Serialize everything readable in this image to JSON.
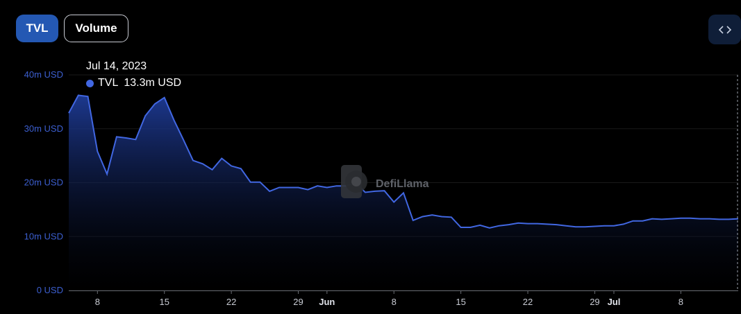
{
  "toggles": {
    "tvl_label": "TVL",
    "volume_label": "Volume"
  },
  "embed_icon": "code-brackets-icon",
  "tooltip": {
    "date": "Jul 14, 2023",
    "series": "TVL",
    "value": "13.3m USD",
    "color": "#4167e2"
  },
  "watermark": {
    "text": "DefiLlama",
    "icon": "llama-logo-icon"
  },
  "colors": {
    "line": "#4167e2",
    "fill_top": "#1e3b96",
    "background": "#000000",
    "grid": "#1a1a1a"
  },
  "chart_data": {
    "type": "area",
    "title": "",
    "xlabel": "",
    "ylabel": "",
    "series": [
      {
        "name": "TVL",
        "x": [
          "2023-05-05",
          "2023-05-06",
          "2023-05-07",
          "2023-05-08",
          "2023-05-09",
          "2023-05-10",
          "2023-05-11",
          "2023-05-12",
          "2023-05-13",
          "2023-05-14",
          "2023-05-15",
          "2023-05-16",
          "2023-05-17",
          "2023-05-18",
          "2023-05-19",
          "2023-05-20",
          "2023-05-21",
          "2023-05-22",
          "2023-05-23",
          "2023-05-24",
          "2023-05-25",
          "2023-05-26",
          "2023-05-27",
          "2023-05-28",
          "2023-05-29",
          "2023-05-30",
          "2023-05-31",
          "2023-06-01",
          "2023-06-02",
          "2023-06-03",
          "2023-06-04",
          "2023-06-05",
          "2023-06-06",
          "2023-06-07",
          "2023-06-08",
          "2023-06-09",
          "2023-06-10",
          "2023-06-11",
          "2023-06-12",
          "2023-06-13",
          "2023-06-14",
          "2023-06-15",
          "2023-06-16",
          "2023-06-17",
          "2023-06-18",
          "2023-06-19",
          "2023-06-20",
          "2023-06-21",
          "2023-06-22",
          "2023-06-23",
          "2023-06-24",
          "2023-06-25",
          "2023-06-26",
          "2023-06-27",
          "2023-06-28",
          "2023-06-29",
          "2023-06-30",
          "2023-07-01",
          "2023-07-02",
          "2023-07-03",
          "2023-07-04",
          "2023-07-05",
          "2023-07-06",
          "2023-07-07",
          "2023-07-08",
          "2023-07-09",
          "2023-07-10",
          "2023-07-11",
          "2023-07-12",
          "2023-07-13",
          "2023-07-14"
        ],
        "values": [
          32.9,
          36.2,
          36.0,
          25.8,
          21.6,
          28.5,
          28.3,
          28.0,
          32.4,
          34.6,
          35.8,
          31.6,
          27.9,
          24.1,
          23.5,
          22.4,
          24.5,
          23.1,
          22.6,
          20.1,
          20.1,
          18.4,
          19.1,
          19.1,
          19.1,
          18.7,
          19.4,
          19.1,
          19.4,
          19.4,
          20.0,
          18.2,
          18.4,
          18.5,
          16.4,
          18.1,
          13.0,
          13.7,
          14.0,
          13.7,
          13.6,
          11.7,
          11.7,
          12.1,
          11.6,
          12.0,
          12.2,
          12.5,
          12.4,
          12.4,
          12.3,
          12.2,
          12.0,
          11.8,
          11.8,
          11.9,
          12.0,
          12.0,
          12.3,
          12.9,
          12.9,
          13.3,
          13.2,
          13.3,
          13.4,
          13.4,
          13.3,
          13.3,
          13.2,
          13.2,
          13.3
        ]
      }
    ],
    "ylim": [
      0,
      40
    ],
    "y_ticks": [
      {
        "value": 0,
        "label": "0 USD"
      },
      {
        "value": 10,
        "label": "10m USD"
      },
      {
        "value": 20,
        "label": "20m USD"
      },
      {
        "value": 30,
        "label": "30m USD"
      },
      {
        "value": 40,
        "label": "40m USD"
      }
    ],
    "x_ticks": [
      {
        "date": "2023-05-08",
        "label": "8",
        "bold": false
      },
      {
        "date": "2023-05-15",
        "label": "15",
        "bold": false
      },
      {
        "date": "2023-05-22",
        "label": "22",
        "bold": false
      },
      {
        "date": "2023-05-29",
        "label": "29",
        "bold": false
      },
      {
        "date": "2023-06-01",
        "label": "Jun",
        "bold": true
      },
      {
        "date": "2023-06-08",
        "label": "8",
        "bold": false
      },
      {
        "date": "2023-06-15",
        "label": "15",
        "bold": false
      },
      {
        "date": "2023-06-22",
        "label": "22",
        "bold": false
      },
      {
        "date": "2023-06-29",
        "label": "29",
        "bold": false
      },
      {
        "date": "2023-07-01",
        "label": "Jul",
        "bold": true
      },
      {
        "date": "2023-07-08",
        "label": "8",
        "bold": false
      }
    ],
    "highlight_date": "2023-07-14",
    "grid": true,
    "legend": "none"
  }
}
